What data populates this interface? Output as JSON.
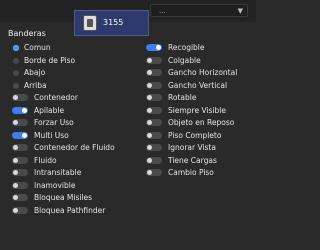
{
  "header": {
    "dropdown_value": "...",
    "popup_value": "3155"
  },
  "section_title": "Banderas",
  "radios": [
    {
      "label": "Comun",
      "selected": true
    },
    {
      "label": "Borde de Piso",
      "selected": false
    },
    {
      "label": "Abajo",
      "selected": false
    },
    {
      "label": "Arriba",
      "selected": false
    }
  ],
  "left_toggles": [
    {
      "label": "Contenedor",
      "on": false
    },
    {
      "label": "Apilable",
      "on": true
    },
    {
      "label": "Forzar Uso",
      "on": false
    },
    {
      "label": "Multi Uso",
      "on": true
    },
    {
      "label": "Contenedor de Fluido",
      "on": false
    },
    {
      "label": "Fluido",
      "on": false
    },
    {
      "label": "Intransitable",
      "on": false
    },
    {
      "label": "Inamovible",
      "on": false
    },
    {
      "label": "Bloquea Misiles",
      "on": false
    },
    {
      "label": "Bloquea Pathfinder",
      "on": false
    }
  ],
  "right_toggles": [
    {
      "label": "Recogible",
      "on": true
    },
    {
      "label": "Colgable",
      "on": false
    },
    {
      "label": "Gancho Horizontal",
      "on": false
    },
    {
      "label": "Gancho Vertical",
      "on": false
    },
    {
      "label": "Rotable",
      "on": false
    },
    {
      "label": "Siempre Visible",
      "on": false
    },
    {
      "label": "Objeto en Reposo",
      "on": false
    },
    {
      "label": "Piso Completo",
      "on": false
    },
    {
      "label": "Ignorar Vista",
      "on": false
    },
    {
      "label": "Tiene Cargas",
      "on": false
    },
    {
      "label": "Cambio Piso",
      "on": false
    }
  ]
}
